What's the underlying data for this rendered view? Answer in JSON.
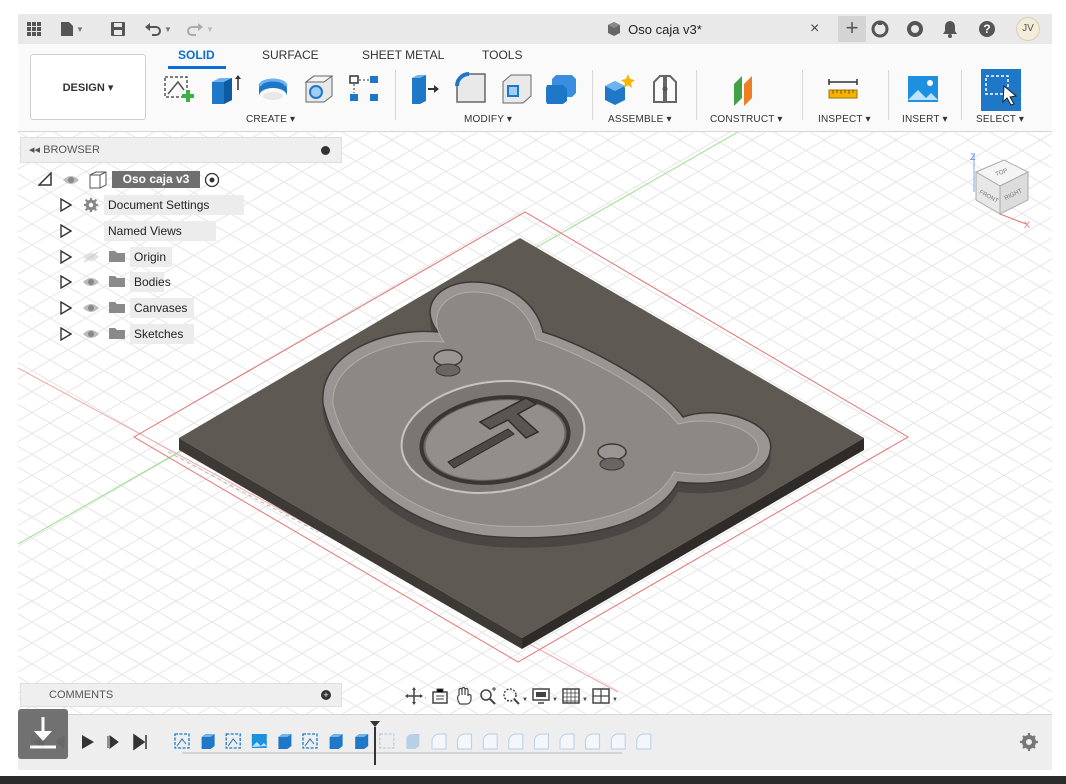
{
  "window": {
    "document_title": "Oso caja v3*",
    "user_initials": "JV"
  },
  "ribbon": {
    "tabs": [
      {
        "label": "SOLID",
        "active": true
      },
      {
        "label": "SURFACE",
        "active": false
      },
      {
        "label": "SHEET METAL",
        "active": false
      },
      {
        "label": "TOOLS",
        "active": false
      }
    ],
    "workspace_label": "DESIGN ▾",
    "groups": [
      {
        "label": "CREATE ▾"
      },
      {
        "label": "MODIFY ▾"
      },
      {
        "label": "ASSEMBLE ▾"
      },
      {
        "label": "CONSTRUCT ▾"
      },
      {
        "label": "INSPECT ▾"
      },
      {
        "label": "INSERT ▾"
      },
      {
        "label": "SELECT ▾"
      }
    ]
  },
  "browser": {
    "header": "BROWSER",
    "root": "Oso caja v3",
    "items": [
      {
        "label": "Document Settings",
        "icon": "gear-icon",
        "visible": null
      },
      {
        "label": "Named Views",
        "icon": "folder-icon",
        "visible": null
      },
      {
        "label": "Origin",
        "icon": "folder-icon",
        "visible": false
      },
      {
        "label": "Bodies",
        "icon": "folder-icon",
        "visible": true
      },
      {
        "label": "Canvases",
        "icon": "folder-icon",
        "visible": true
      },
      {
        "label": "Sketches",
        "icon": "folder-icon",
        "visible": true
      }
    ]
  },
  "comments": {
    "label": "COMMENTS"
  },
  "viewcube": {
    "faces": [
      "TOP",
      "FRONT",
      "RIGHT"
    ],
    "axes": [
      "Z",
      "X"
    ]
  },
  "colors": {
    "accent": "#0a6ed1",
    "plate": "#5e5953",
    "grid": "#e3e3e3"
  }
}
